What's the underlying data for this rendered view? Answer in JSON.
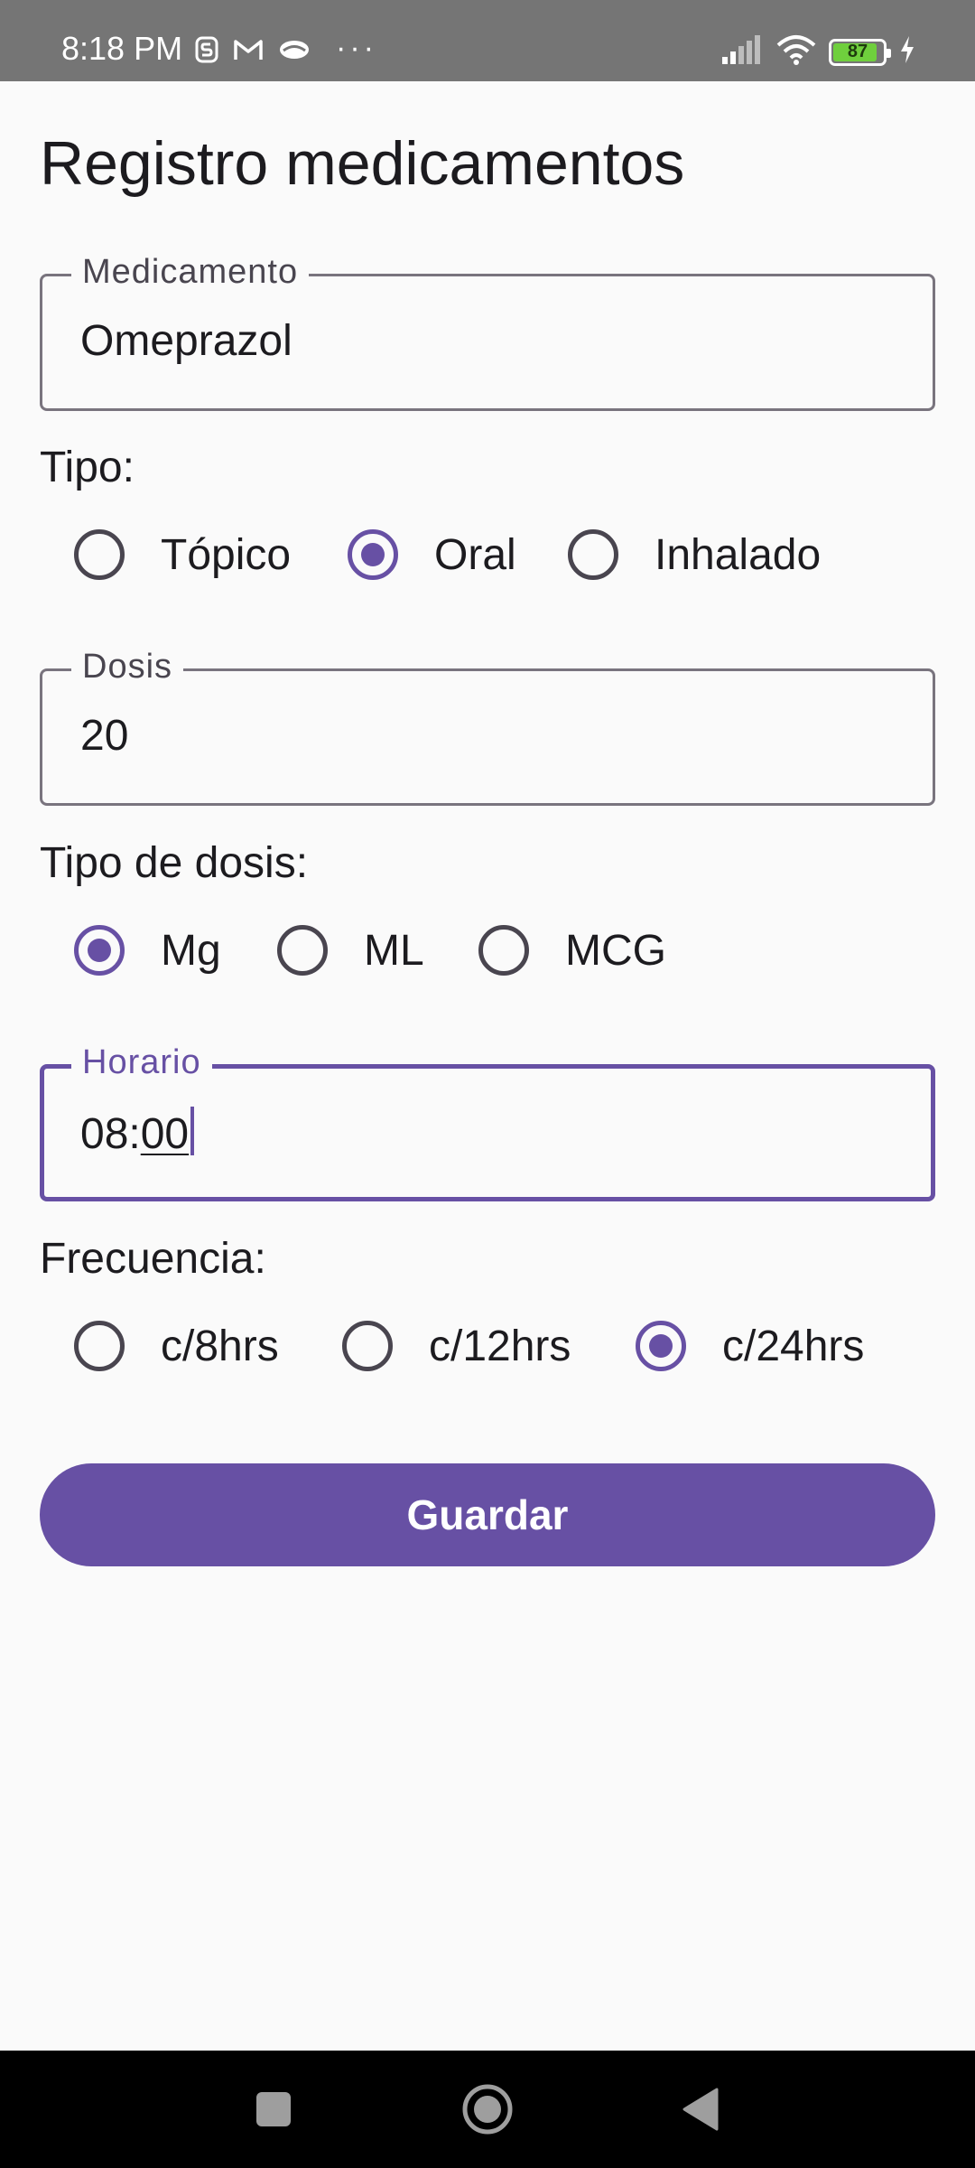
{
  "status_bar": {
    "time": "8:18 PM",
    "battery": "87",
    "icons": [
      "s-icon",
      "gmail-icon",
      "cloud-icon",
      "more-icon",
      "signal-icon",
      "wifi-icon",
      "battery-icon",
      "charging-icon"
    ]
  },
  "title": "Registro medicamentos",
  "medicamento": {
    "label": "Medicamento",
    "value": "Omeprazol"
  },
  "tipo": {
    "label": "Tipo:",
    "options": [
      "Tópico",
      "Oral",
      "Inhalado"
    ],
    "selected": "Oral"
  },
  "dosis": {
    "label": "Dosis",
    "value": "20"
  },
  "tipo_dosis": {
    "label": "Tipo de dosis:",
    "options": [
      "Mg",
      "ML",
      "MCG"
    ],
    "selected": "Mg"
  },
  "horario": {
    "label": "Horario",
    "value_prefix": "08:",
    "value_composing": "00"
  },
  "frecuencia": {
    "label": "Frecuencia:",
    "options": [
      "c/8hrs",
      "c/12hrs",
      "c/24hrs"
    ],
    "selected": "c/24hrs"
  },
  "save_label": "Guardar",
  "colors": {
    "primary": "#6750a4",
    "status_bar": "#757575",
    "background": "#fafafa"
  }
}
